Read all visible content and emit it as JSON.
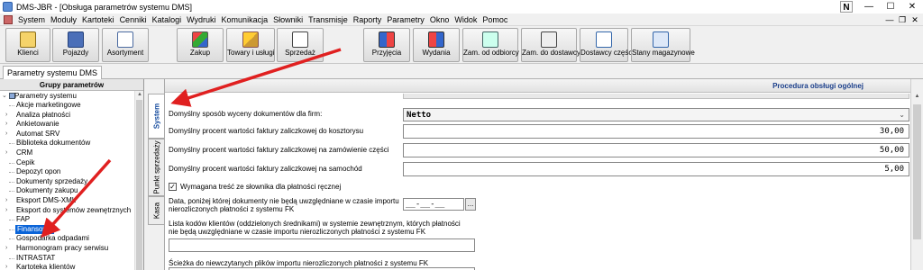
{
  "window": {
    "title": "DMS-JBR - [Obsługa parametrów systemu DMS]",
    "badge": "N",
    "controls": [
      "—",
      "☐",
      "✕"
    ]
  },
  "menu": {
    "items": [
      "System",
      "Moduły",
      "Kartoteki",
      "Cenniki",
      "Katalogi",
      "Wydruki",
      "Komunikacja",
      "Słowniki",
      "Transmisje",
      "Raporty",
      "Parametry",
      "Okno",
      "Widok",
      "Pomoc"
    ],
    "mdi_controls": [
      "—",
      "❐",
      "✕"
    ]
  },
  "toolbar": {
    "buttons": [
      {
        "label": "Klienci",
        "icon": "clients-icon"
      },
      {
        "label": "Pojazdy",
        "icon": "car-icon"
      },
      {
        "label": "Asortyment",
        "icon": "list-icon"
      },
      {
        "label": "Zakup",
        "icon": "purchase-icon"
      },
      {
        "label": "Towary i usługi",
        "icon": "goods-icon"
      },
      {
        "label": "Sprzedaż",
        "icon": "sales-icon"
      },
      {
        "label": "Przyjęcia",
        "icon": "receipts-icon"
      },
      {
        "label": "Wydania",
        "icon": "issues-icon"
      },
      {
        "label": "Zam. od odbiorcy",
        "icon": "customer-order-icon"
      },
      {
        "label": "Zam. do dostawcy",
        "icon": "supplier-order-icon"
      },
      {
        "label": "Dostawcy części",
        "icon": "parts-suppliers-icon"
      },
      {
        "label": "Stany magazynowe",
        "icon": "stock-icon"
      }
    ]
  },
  "doc_tab": {
    "label": "Parametry systemu DMS"
  },
  "left_panel": {
    "header": "Grupy parametrów",
    "root": "Parametry systemu",
    "items": [
      {
        "label": "Akcje marketingowe",
        "expandable": false
      },
      {
        "label": "Analiza płatności",
        "expandable": true
      },
      {
        "label": "Ankietowanie",
        "expandable": true
      },
      {
        "label": "Automat SRV",
        "expandable": true
      },
      {
        "label": "Biblioteka dokumentów",
        "expandable": false
      },
      {
        "label": "CRM",
        "expandable": true
      },
      {
        "label": "Cepik",
        "expandable": false
      },
      {
        "label": "Depozyt opon",
        "expandable": false
      },
      {
        "label": "Dokumenty sprzedaży",
        "expandable": false
      },
      {
        "label": "Dokumenty zakupu",
        "expandable": false
      },
      {
        "label": "Eksport DMS-XML",
        "expandable": true
      },
      {
        "label": "Eksport do systemów zewnętrznych",
        "expandable": true
      },
      {
        "label": "FAP",
        "expandable": false
      },
      {
        "label": "Finansowe",
        "expandable": false,
        "selected": true
      },
      {
        "label": "Gospodarka odpadami",
        "expandable": false
      },
      {
        "label": "Harmonogram pracy serwisu",
        "expandable": true
      },
      {
        "label": "INTRASTAT",
        "expandable": false
      },
      {
        "label": "Kartoteka klientów",
        "expandable": true
      }
    ]
  },
  "vertical_tabs": [
    "System",
    "Punkt sprzedaży",
    "Kasa"
  ],
  "content": {
    "header": "Procedura obsługi ogólnej",
    "valuation": {
      "label": "Domyślny sposób wyceny dokumentów dla firm:",
      "value": "Netto"
    },
    "pct_estimate": {
      "label": "Domyślny procent wartości faktury zaliczkowej do kosztorysu",
      "value": "30,00"
    },
    "pct_parts": {
      "label": "Domyślny procent wartości faktury zaliczkowej na zamówienie części",
      "value": "50,00"
    },
    "pct_car": {
      "label": "Domyślny procent wartości faktury zaliczkowej na samochód",
      "value": "5,00"
    },
    "required_checkbox": {
      "label": "Wymagana treść ze słownika dla płatności ręcznej",
      "checked": true
    },
    "date_param": {
      "label_line1": "Data, poniżej której dokumenty nie będą uwzględniane w czasie importu",
      "label_line2": "nierozliczonych płatności z systemu FK",
      "value": "__-__-__",
      "button": "..."
    },
    "client_codes": {
      "label_line1": "Lista kodów klientów (oddzielonych średnikami) w systemie zewnętrznym, których płatności",
      "label_line2": "nie będą uwzględniane w czasie importu nierozliczonych płatności z systemu FK",
      "value": ""
    },
    "path_param": {
      "label": "Ścieżka do niewczytanych plików importu nierozliczonych płatności z systemu FK"
    }
  }
}
